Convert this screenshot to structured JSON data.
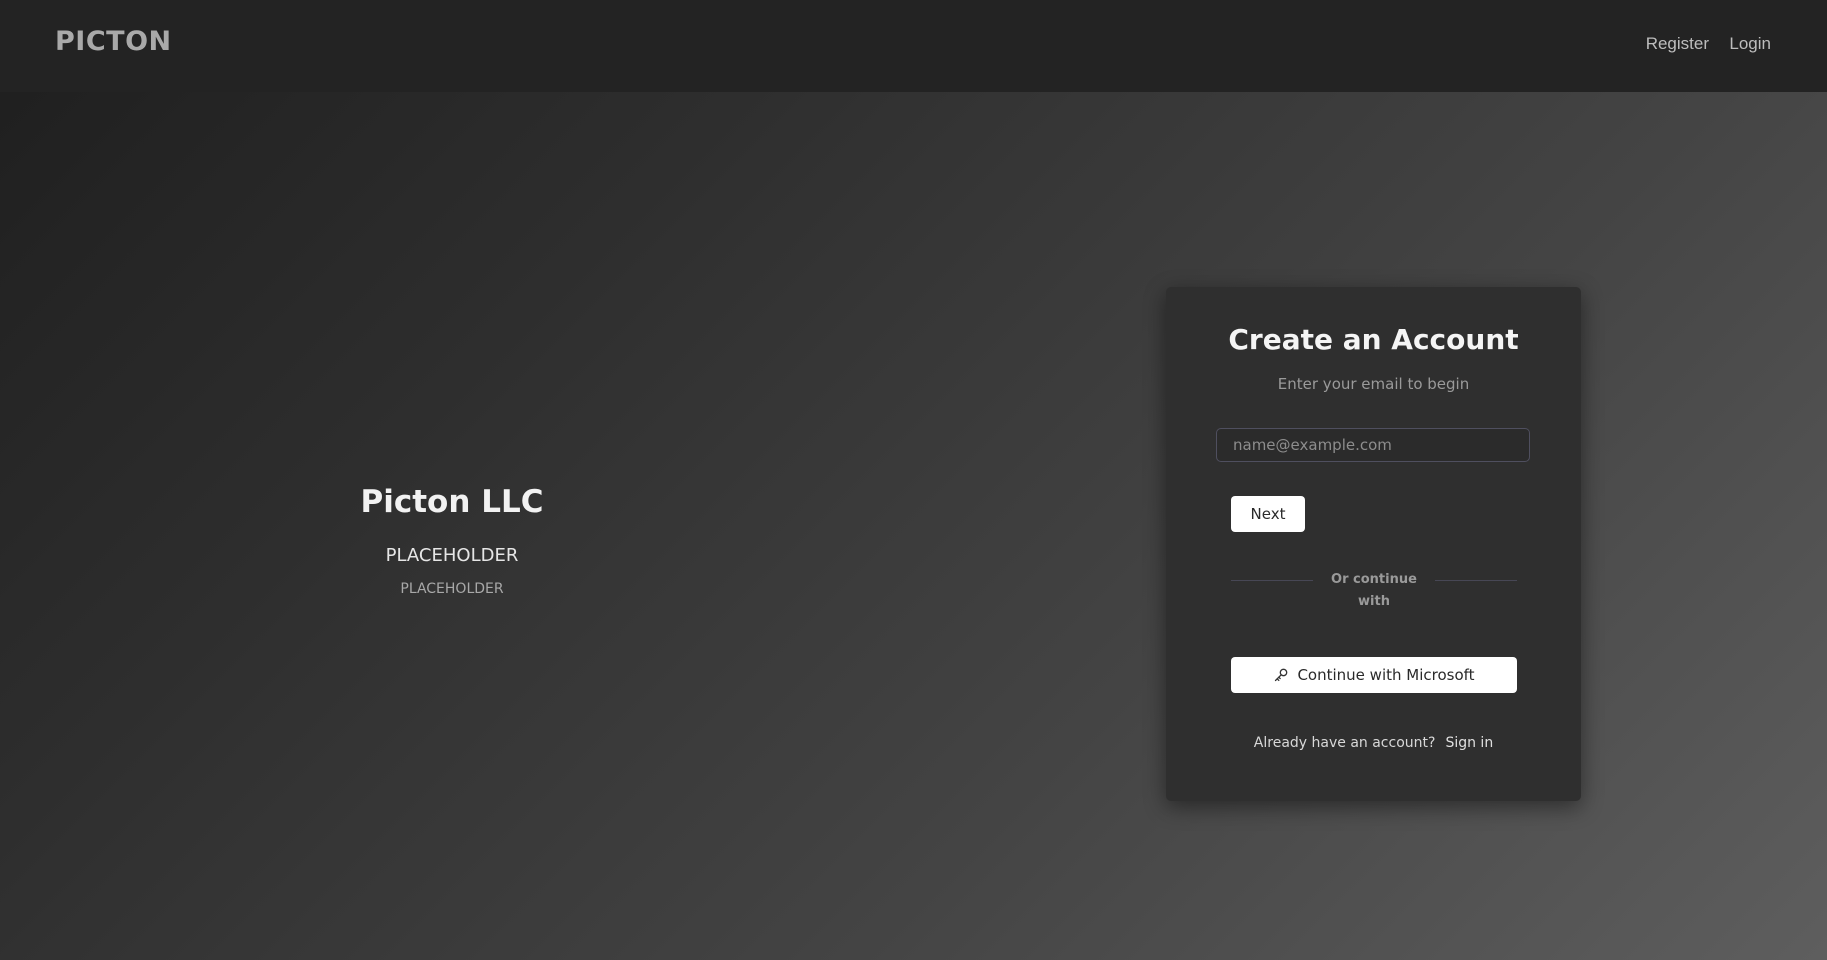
{
  "header": {
    "brand": "PICTON",
    "nav": {
      "register": "Register",
      "login": "Login"
    }
  },
  "hero": {
    "title": "Picton LLC",
    "subtitle": "PLACEHOLDER",
    "caption": "PLACEHOLDER"
  },
  "signup_card": {
    "title": "Create an Account",
    "subtitle": "Enter your email to begin",
    "email": {
      "value": "",
      "placeholder": "name@example.com"
    },
    "next_label": "Next",
    "divider_text": "Or continue with",
    "microsoft_button": {
      "label": "Continue with Microsoft",
      "icon": "key-icon"
    },
    "footer": {
      "prompt": "Already have an account?",
      "signin_label": "Sign in"
    }
  },
  "colors": {
    "header_bg": "#232323",
    "card_bg": "#2f2f2f",
    "button_bg": "#ffffff"
  }
}
